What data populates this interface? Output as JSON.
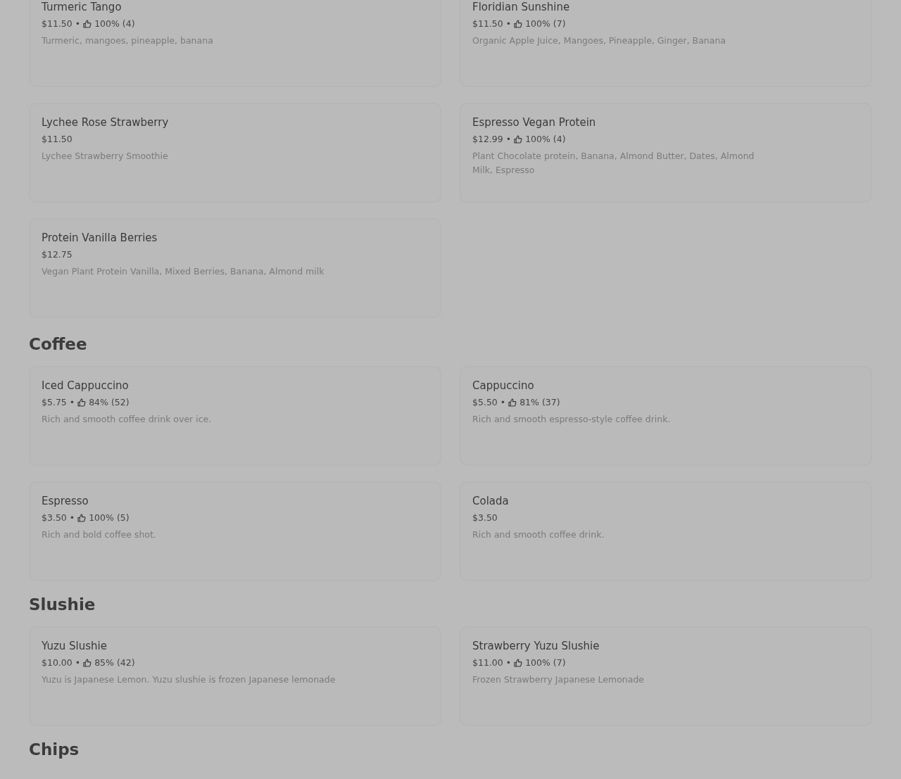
{
  "sections": [
    {
      "items": [
        {
          "name": "Turmeric Tango",
          "price": "$11.50",
          "separator": "•",
          "rating": "100% (4)",
          "description": "Turmeric, mangoes, pineapple, banana"
        },
        {
          "name": "Floridian Sunshine",
          "price": "$11.50",
          "separator": "•",
          "rating": "100% (7)",
          "description": "Organic Apple Juice, Mangoes, Pineapple, Ginger, Banana"
        },
        {
          "name": "Lychee Rose Strawberry",
          "price": "$11.50",
          "description": "Lychee Strawberry Smoothie"
        },
        {
          "name": "Espresso Vegan Protein",
          "price": "$12.99",
          "separator": "•",
          "rating": "100% (4)",
          "description": "Plant Chocolate protein, Banana, Almond Butter, Dates, Almond Milk, Espresso"
        },
        {
          "name": "Protein Vanilla Berries",
          "price": "$12.75",
          "description": "Vegan Plant Protein Vanilla, Mixed Berries, Banana, Almond milk"
        }
      ]
    },
    {
      "title": "Coffee",
      "items": [
        {
          "name": "Iced Cappuccino",
          "price": "$5.75",
          "separator": "•",
          "rating": "84% (52)",
          "description": "Rich and smooth coffee drink over ice."
        },
        {
          "name": "Cappuccino",
          "price": "$5.50",
          "separator": "•",
          "rating": "81% (37)",
          "description": "Rich and smooth espresso-style coffee drink."
        },
        {
          "name": "Espresso",
          "price": "$3.50",
          "separator": "•",
          "rating": "100% (5)",
          "description": "Rich and bold coffee shot."
        },
        {
          "name": "Colada",
          "price": "$3.50",
          "description": "Rich and smooth coffee drink."
        }
      ]
    },
    {
      "title": "Slushie",
      "items": [
        {
          "name": "Yuzu Slushie",
          "price": "$10.00",
          "separator": "•",
          "rating": "85% (42)",
          "description": "Yuzu is Japanese Lemon. Yuzu slushie is frozen Japanese lemonade"
        },
        {
          "name": "Strawberry Yuzu Slushie",
          "price": "$11.00",
          "separator": "•",
          "rating": "100% (7)",
          "description": "Frozen Strawberry Japanese Lemonade"
        }
      ]
    },
    {
      "title": "Chips"
    }
  ]
}
